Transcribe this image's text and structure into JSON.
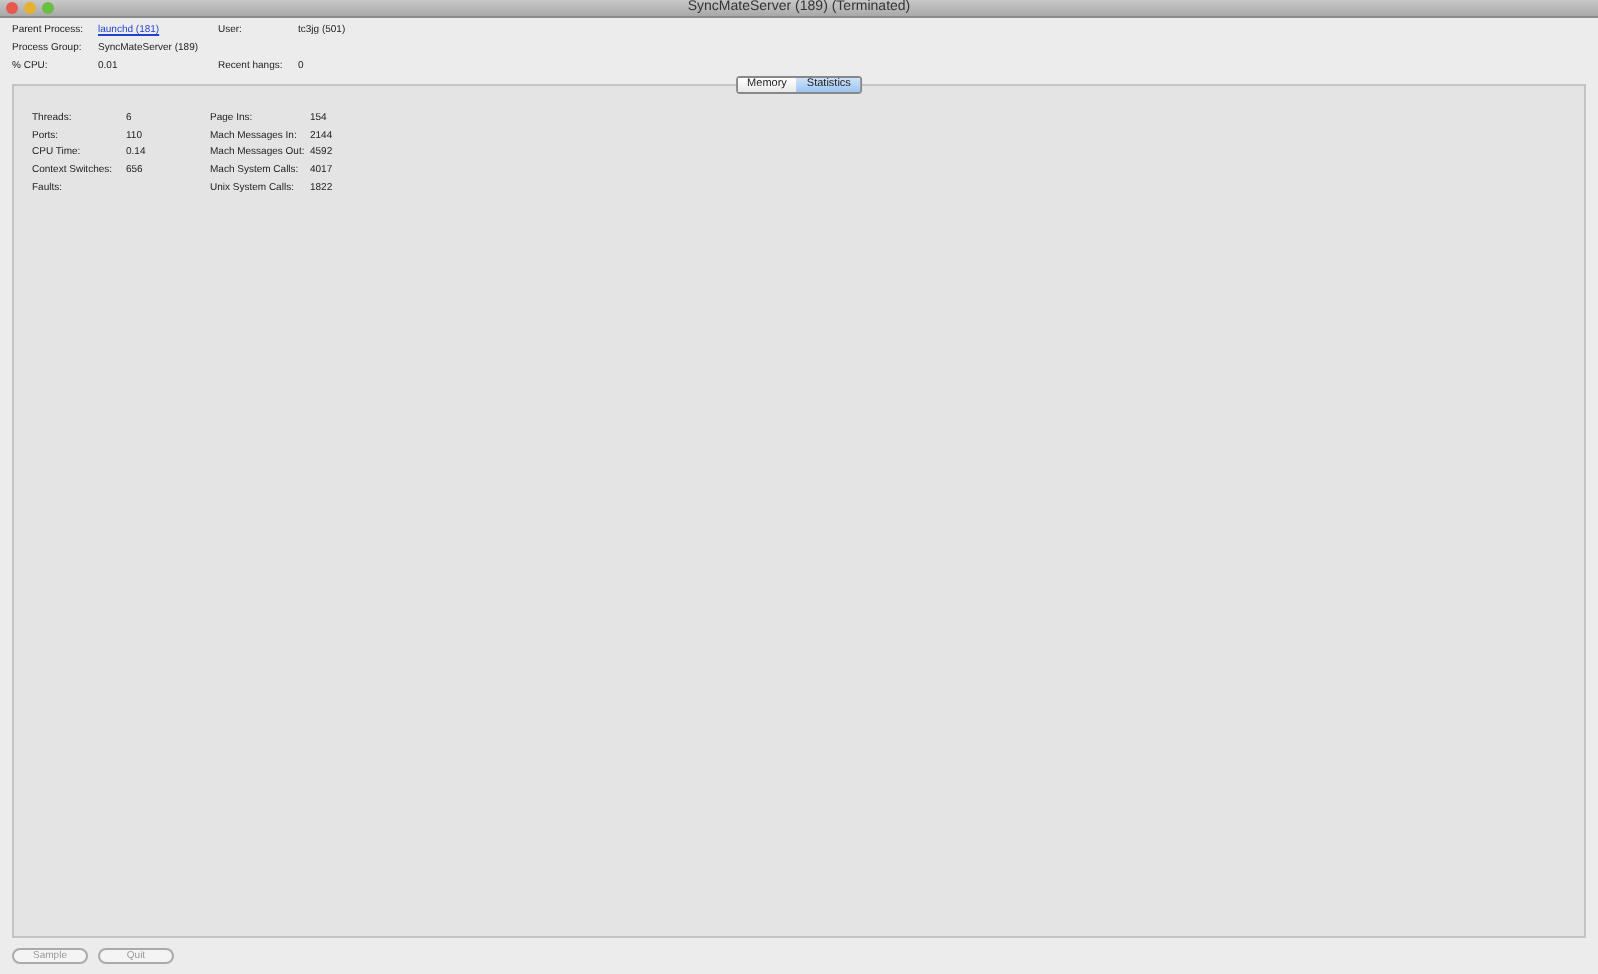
{
  "window": {
    "title": "SyncMateServer (189) (Terminated)"
  },
  "info": [
    {
      "label": "Parent Process:",
      "value": "launchd (181)",
      "kind": "link"
    },
    {
      "label": "User:",
      "value": "tc3jg (501)",
      "kind": "text"
    },
    {
      "label": "Process Group:",
      "value": "SyncMateServer (189)",
      "kind": "text"
    },
    {
      "label": "% CPU:",
      "value": "0.01",
      "kind": "text"
    },
    {
      "label": "Recent hangs:",
      "value": "0",
      "kind": "text"
    }
  ],
  "tabs": [
    {
      "label": "Memory",
      "selected": false
    },
    {
      "label": "Statistics",
      "selected": true
    }
  ],
  "stats_left": [
    {
      "label": "Threads:",
      "value": "6"
    },
    {
      "label": "Ports:",
      "value": "110"
    },
    {
      "label": "CPU Time:",
      "value": "0.14"
    },
    {
      "label": "Context Switches:",
      "value": "656"
    },
    {
      "label": "Faults:"
    }
  ],
  "stats_right": [
    {
      "label": "Page Ins:",
      "value": "154"
    },
    {
      "label": "Mach Messages In:",
      "value": "2144"
    },
    {
      "label": "Mach Messages Out:",
      "value": "4592"
    },
    {
      "label": "Mach System Calls:",
      "value": "4017"
    },
    {
      "label": "Unix System Calls:",
      "value": "1822"
    }
  ],
  "buttons": [
    {
      "label": "Sample",
      "disabled": true
    },
    {
      "label": "Quit",
      "disabled": true
    }
  ]
}
